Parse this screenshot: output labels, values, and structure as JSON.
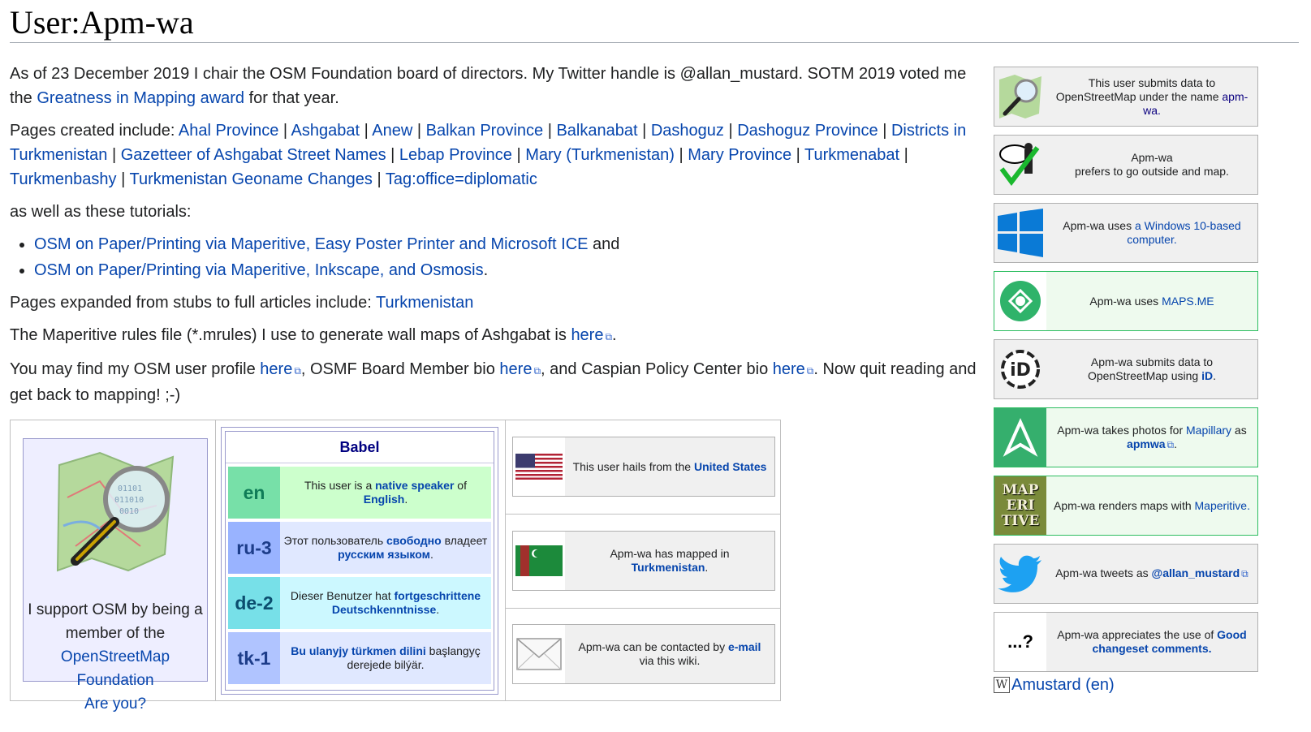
{
  "page": {
    "title": "User:Apm-wa"
  },
  "intro": {
    "text1": "As of 23 December 2019 I chair the OSM Foundation board of directors. My Twitter handle is @allan_mustard. SOTM 2019 voted me the ",
    "award_link": "Greatness in Mapping award",
    "text2": " for that year."
  },
  "pages_created": {
    "label": "Pages created include: ",
    "links": [
      "Ahal Province",
      "Ashgabat",
      "Anew",
      "Balkan Province",
      "Balkanabat",
      "Dashoguz",
      "Dashoguz Province",
      "Districts in Turkmenistan",
      "Gazetteer of Ashgabat Street Names",
      "Lebap Province",
      "Mary (Turkmenistan)",
      "Mary Province",
      "Turkmenabat",
      "Turkmenbashy",
      "Turkmenistan Geoname Changes",
      "Tag:office=diplomatic"
    ],
    "separator": " | "
  },
  "tutorials": {
    "label": "as well as these tutorials:",
    "items": [
      {
        "link": "OSM on Paper/Printing via Maperitive, Easy Poster Printer and Microsoft ICE",
        "suffix": " and"
      },
      {
        "link": "OSM on Paper/Printing via Maperitive, Inkscape, and Osmosis",
        "suffix": "."
      }
    ]
  },
  "expanded": {
    "label": "Pages expanded from stubs to full articles include: ",
    "link": "Turkmenistan"
  },
  "mrules": {
    "text": "The Maperitive rules file (*.mrules) I use to generate wall maps of Ashgabat is ",
    "link": "here",
    "end": "."
  },
  "profile": {
    "t1": "You may find my OSM user profile ",
    "l1": "here",
    "t2": ", OSMF Board Member bio ",
    "l2": "here",
    "t3": ", and Caspian Policy Center bio ",
    "l3": "here",
    "t4": ". Now quit reading and get back to mapping! ;-)"
  },
  "osmf_box": {
    "line1": "I support OSM by being a member of the",
    "link": "OpenStreetMap Foundation",
    "question": "Are you?"
  },
  "babel": {
    "title": "Babel",
    "langs": [
      {
        "code": "en",
        "pre": "This user is a ",
        "bold1": "native speaker",
        "mid": " of ",
        "bold2": "English",
        "post": ".",
        "color_code": "#77e0a8",
        "color_text": "#ccffcc",
        "code_color": "#0f7c57"
      },
      {
        "code": "ru-3",
        "pre": "Этот пользователь ",
        "bold1": "свободно",
        "mid": " владеет ",
        "bold2": "русским языком",
        "post": ".",
        "color_code": "#99b3ff",
        "color_text": "#e0e8ff",
        "code_color": "#1d3d8a"
      },
      {
        "code": "de-2",
        "pre": "Dieser Benutzer hat ",
        "bold1": "fortgeschrittene",
        "mid": " ",
        "bold2": "Deutschkenntnisse",
        "post": ".",
        "color_code": "#77e0e8",
        "color_text": "#ccf8ff",
        "code_color": "#0b4d6e"
      },
      {
        "code": "tk-1",
        "pre": "",
        "bold1": "Bu ulanyjy türkmen dilini",
        "mid": " başlangyç derejede bilýär.",
        "bold2": "",
        "post": "",
        "color_code": "#b0c4ff",
        "color_text": "#e0e8ff",
        "code_color": "#1d3d8a"
      }
    ]
  },
  "middle_boxes": [
    {
      "pre": "This user hails from the ",
      "link": "United States",
      "post": "",
      "icon": "us-flag-icon"
    },
    {
      "pre": "Apm-wa has mapped in ",
      "link": "Turkmenistan",
      "post": ".",
      "icon": "turkmenistan-flag-icon"
    },
    {
      "pre": "Apm-wa can be contacted by ",
      "link": "e-mail",
      "post": " via this wiki.",
      "icon": "envelope-icon"
    }
  ],
  "userboxes": [
    {
      "t1": "This user submits data to OpenStreetMap under the name ",
      "link": "apm-wa.",
      "t2": "",
      "icon": "osm-magnifier-icon"
    },
    {
      "t1": "Apm-wa",
      "t2": "prefers to go outside and map.",
      "icon": "outside-map-icon"
    },
    {
      "t1": "Apm-wa uses ",
      "link": "a Windows 10-based computer.",
      "icon": "windows-icon"
    },
    {
      "t1": "Apm-wa uses ",
      "link": "MAPS.ME",
      "icon": "mapsme-icon"
    },
    {
      "t1": "Apm-wa submits data to OpenStreetMap using ",
      "link": "iD",
      "t2": ".",
      "icon": "id-editor-icon"
    },
    {
      "t1": "Apm-wa takes photos for ",
      "link": "Mapillary",
      "t2": " as ",
      "link2": "apmwa",
      "t3": ".",
      "icon": "mapillary-icon"
    },
    {
      "t1": "Apm-wa renders maps with ",
      "link": "Maperitive.",
      "icon": "maperitive-icon",
      "icon_text": [
        "MAP",
        "ERI",
        "TIVE"
      ]
    },
    {
      "t1": "Apm-wa tweets as ",
      "link": "@allan_mustard",
      "icon": "twitter-icon"
    },
    {
      "t1": "Apm-wa appreciates the use of ",
      "link": "Good changeset comments.",
      "icon": "question-icon",
      "icon_text": "...?"
    }
  ],
  "wiki_link": {
    "text": "Amustard (en)",
    "icon_letter": "W"
  },
  "colors": {
    "link": "#0645ad",
    "visited": "#0b0080",
    "green_border": "#2dbd60",
    "mapillary": "#35af6d",
    "maps_me": "#2fb36a"
  }
}
